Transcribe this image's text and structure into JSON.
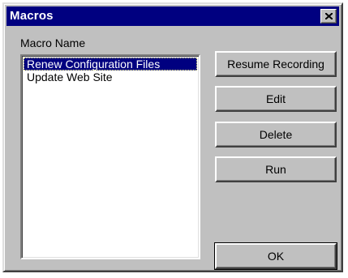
{
  "window": {
    "title": "Macros",
    "close_icon": "close-icon"
  },
  "macro_list": {
    "label": "Macro Name",
    "items": [
      {
        "label": "Renew Configuration Files",
        "selected": true
      },
      {
        "label": "Update Web Site",
        "selected": false
      }
    ]
  },
  "buttons": {
    "resume_recording": "Resume Recording",
    "edit": "Edit",
    "delete": "Delete",
    "run": "Run",
    "ok": "OK"
  },
  "colors": {
    "titlebar": "#000080",
    "face": "#c0c0c0",
    "selection": "#000080"
  }
}
